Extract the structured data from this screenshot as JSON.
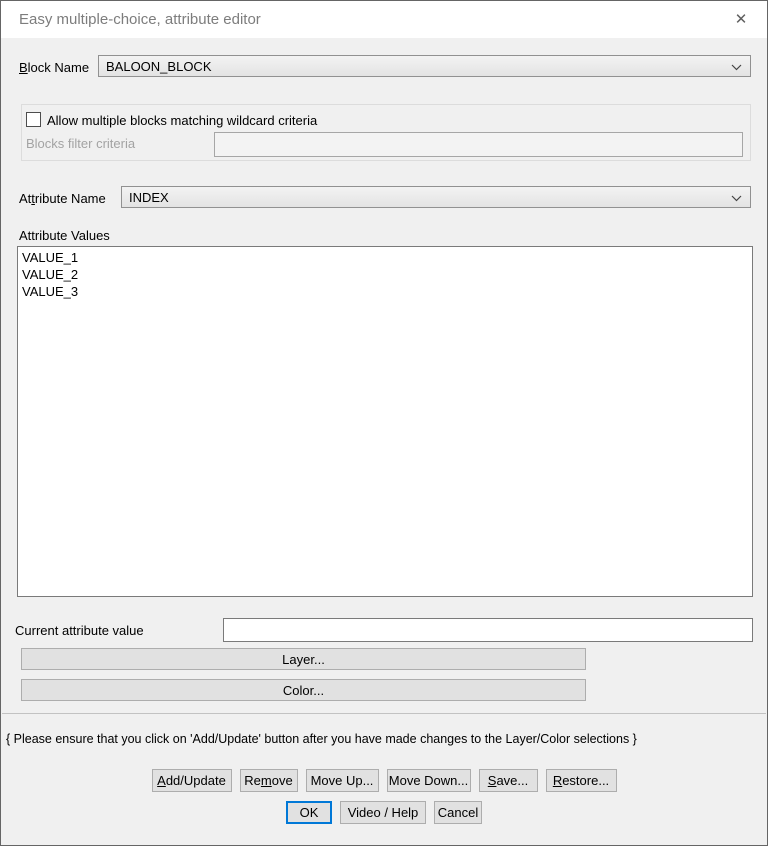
{
  "window": {
    "title": "Easy multiple-choice, attribute editor",
    "close_glyph": "✕"
  },
  "colors": {
    "dialog_bg": "#f0f0f0",
    "titlebar_bg": "#ffffff",
    "title_text": "#7d7d7d",
    "button_bg": "#e1e1e1",
    "button_border": "#adadad",
    "focus_accent": "#0078d7",
    "disabled_text": "#a3a3a3"
  },
  "block_name": {
    "label_key": "B",
    "label_rest": "lock Name",
    "value": "BALOON_BLOCK"
  },
  "wildcard": {
    "checkbox_label": "Allow multiple blocks matching wildcard criteria",
    "checked": false,
    "filter_label": "Blocks filter criteria",
    "filter_value": ""
  },
  "attribute_name": {
    "label_pre": "At",
    "label_key": "t",
    "label_rest": "ribute Name",
    "value": "INDEX"
  },
  "attribute_values": {
    "label": "Attribute Values",
    "items": [
      "VALUE_1",
      "VALUE_2",
      "VALUE_3"
    ]
  },
  "current_attribute": {
    "label": "Current attribute value",
    "value": ""
  },
  "layer_color": {
    "layer_label": "Layer...",
    "color_label": "Color..."
  },
  "note": "{ Please ensure that you click on 'Add/Update' button after you have made changes to the Layer/Color selections }",
  "action_buttons": [
    {
      "pre": "",
      "key": "A",
      "rest": "dd/Update"
    },
    {
      "pre": "Re",
      "key": "m",
      "rest": "ove"
    },
    {
      "pre": "Move Up...",
      "key": "",
      "rest": ""
    },
    {
      "pre": "Move Down...",
      "key": "",
      "rest": ""
    },
    {
      "pre": "",
      "key": "S",
      "rest": "ave..."
    },
    {
      "pre": "",
      "key": "R",
      "rest": "estore..."
    }
  ],
  "dialog_buttons": {
    "ok": "OK",
    "video_help": "Video / Help",
    "cancel": "Cancel"
  }
}
